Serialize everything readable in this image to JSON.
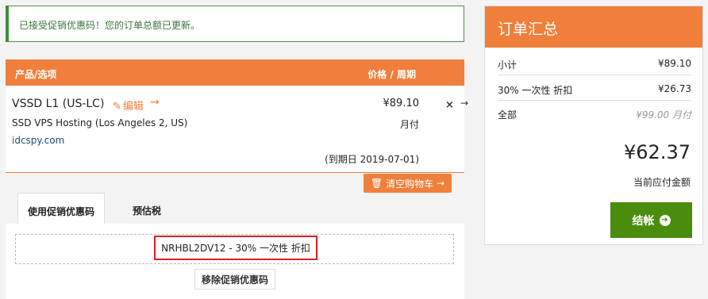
{
  "alert": {
    "message": "已接受促销优惠码！您的订单总额已更新。"
  },
  "cart": {
    "header_left": "产品/选项",
    "header_right": "价格 / 周期",
    "item": {
      "title": "VSSD L1 (US-LC)",
      "edit_label": "编辑",
      "edit_arrow": "→",
      "subtitle": "SSD VPS Hosting (Los Angeles 2, US)",
      "domain": "idcspy.com",
      "price": "¥89.10",
      "cycle": "月付",
      "due": "(到期日 2019-07-01)"
    },
    "remove_icon": "×",
    "move_icon": "→",
    "empty_cart_label": "清空购物车",
    "empty_cart_arrow": "→"
  },
  "tabs": [
    {
      "label": "使用促销优惠码"
    },
    {
      "label": "预估税"
    }
  ],
  "promo": {
    "code_text": "NRHBL2DV12 - 30% 一次性 折扣",
    "remove_label": "移除促销优惠码"
  },
  "summary": {
    "title": "订单汇总",
    "rows": [
      {
        "label": "小计",
        "value": "¥89.10"
      },
      {
        "label": "30% 一次性 折扣",
        "value": "¥26.73"
      },
      {
        "label": "全部",
        "value": "¥99.00 月付"
      }
    ],
    "grand_total": "¥62.37",
    "grand_label": "当前应付金额",
    "checkout_label": "结帐",
    "checkout_arrow": "➔"
  },
  "colors": {
    "accent": "#ef7f3b",
    "success": "#3c763d",
    "checkout": "#4a8c0c",
    "highlight": "#e02020"
  }
}
